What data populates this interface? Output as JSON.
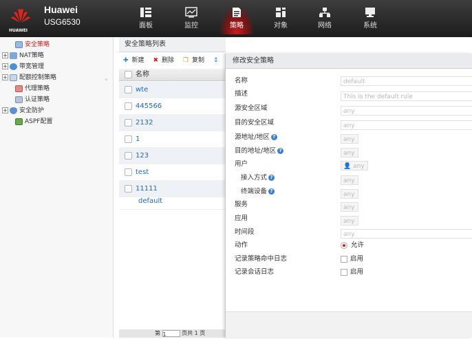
{
  "brand": {
    "name": "Huawei",
    "model": "USG6530",
    "logo_text": "HUAWEI"
  },
  "nav": [
    {
      "label": "面板",
      "icon": "dashboard-icon"
    },
    {
      "label": "监控",
      "icon": "monitor-icon"
    },
    {
      "label": "策略",
      "icon": "policy-icon",
      "active": true
    },
    {
      "label": "对象",
      "icon": "object-icon"
    },
    {
      "label": "网络",
      "icon": "network-icon"
    },
    {
      "label": "系统",
      "icon": "system-icon"
    }
  ],
  "sidebar": {
    "items": [
      {
        "label": "安全策略",
        "icon": "security-policy-icon",
        "active": true
      },
      {
        "label": "NAT策略",
        "icon": "nat-policy-icon"
      },
      {
        "label": "带宽管理",
        "icon": "bandwidth-icon"
      },
      {
        "label": "配额控制策略",
        "icon": "quota-control-icon"
      },
      {
        "label": "代理策略",
        "icon": "proxy-policy-icon"
      },
      {
        "label": "认证策略",
        "icon": "auth-policy-icon"
      },
      {
        "label": "安全防护",
        "icon": "security-protection-icon"
      },
      {
        "label": "ASPF配置",
        "icon": "aspf-icon"
      }
    ]
  },
  "list": {
    "title": "安全策略列表",
    "toolbar": {
      "new": "新建",
      "delete": "删除",
      "copy": "复制"
    },
    "column_name": "名称",
    "rows": [
      "wte",
      "445566",
      "2132",
      "1",
      "123",
      "test",
      "11111",
      "default"
    ],
    "pager": {
      "prefix": "第",
      "page": "1",
      "suffix": "页共 1 页"
    }
  },
  "dialog": {
    "title": "修改安全策略",
    "fields": {
      "name": {
        "label": "名称",
        "value": "default"
      },
      "description": {
        "label": "描述",
        "value": "This is the default rule"
      },
      "src_zone": {
        "label": "源安全区域",
        "value": "any"
      },
      "dst_zone": {
        "label": "目的安全区域",
        "value": "any"
      },
      "src_addr": {
        "label": "源地址/地区",
        "value": "any"
      },
      "dst_addr": {
        "label": "目的地址/地区",
        "value": "any"
      },
      "user": {
        "label": "用户",
        "value": "any"
      },
      "access_mode": {
        "label": "接入方式",
        "value": "any"
      },
      "terminal": {
        "label": "终端设备",
        "value": "any"
      },
      "service": {
        "label": "服务",
        "value": "any"
      },
      "application": {
        "label": "应用",
        "value": "any"
      },
      "time_range": {
        "label": "时间段",
        "value": "any"
      },
      "action": {
        "label": "动作",
        "value": "允许"
      },
      "policy_log": {
        "label": "记录策略命中日志",
        "value": "启用"
      },
      "session_log": {
        "label": "记录会话日志",
        "value": "启用"
      }
    }
  },
  "colors": {
    "accent_red": "#d51d1d",
    "link_blue": "#1f66c4",
    "topbar": "#2a2a2a"
  }
}
